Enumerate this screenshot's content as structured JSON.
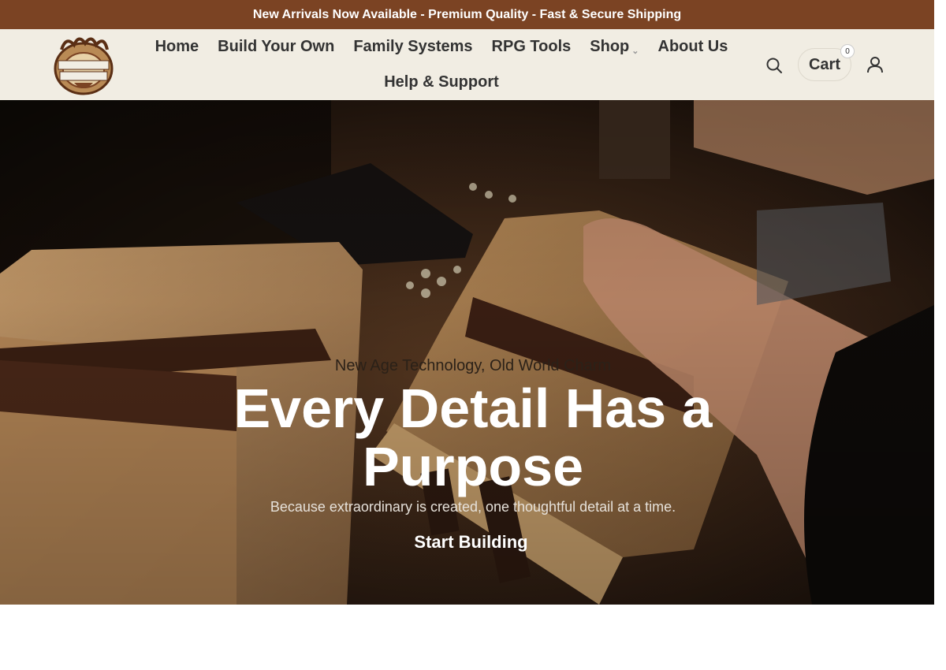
{
  "announcement": {
    "text": "New Arrivals Now Available - Premium Quality - Fast & Secure Shipping"
  },
  "header": {
    "logo_text": "ANCIENT INNOVATIONS",
    "nav": [
      {
        "label": "Home"
      },
      {
        "label": "Build Your Own"
      },
      {
        "label": "Family Systems"
      },
      {
        "label": "RPG Tools"
      },
      {
        "label": "Shop"
      },
      {
        "label": "About Us"
      },
      {
        "label": "Help & Support"
      }
    ],
    "search_icon": "search-icon",
    "cart_label": "Cart",
    "cart_count": "0",
    "account_icon": "user-icon"
  },
  "hero": {
    "eyebrow": "New Age Technology, Old World Charm",
    "title": "Every Detail Has a Purpose",
    "subtitle": "Because extraordinary is created, one thoughtful detail at a time.",
    "cta": "Start Building"
  },
  "colors": {
    "announcement_bg": "#7b4323",
    "header_bg": "#f1ede3",
    "nav_text": "#333333",
    "hero_text": "#ffffff"
  }
}
